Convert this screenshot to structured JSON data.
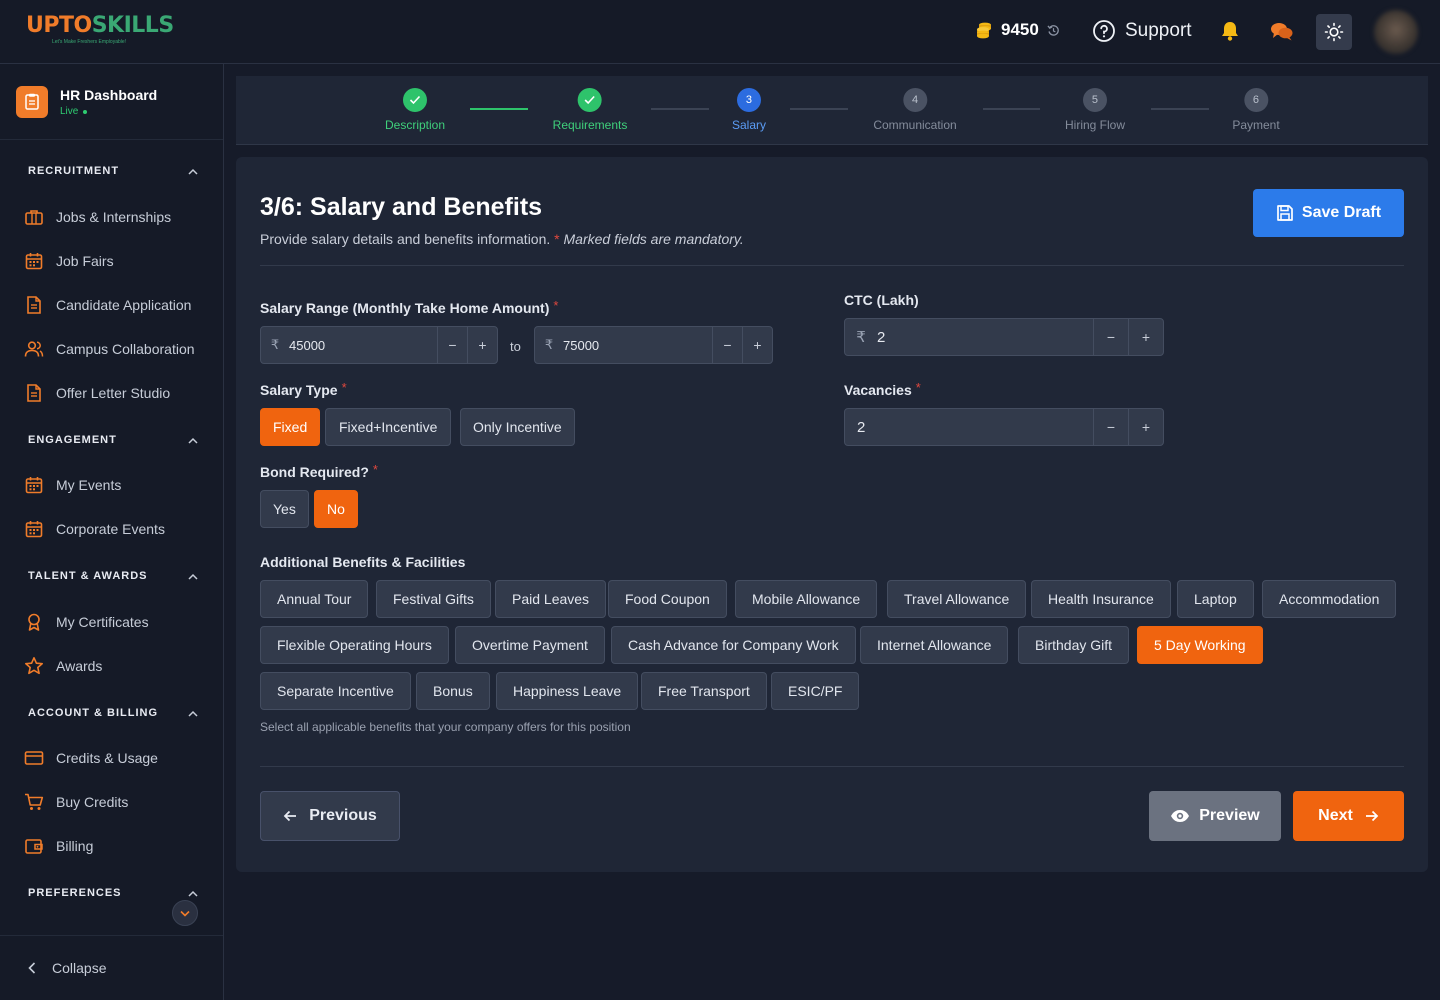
{
  "header": {
    "logo_prefix": "UPTO",
    "logo_suffix": "SKILLS",
    "logo_tagline": "Let's Make Freshers Employable!",
    "credits": "9450",
    "support_label": "Support"
  },
  "sidebar": {
    "dashboard_title": "HR Dashboard",
    "dashboard_status": "Live",
    "sections": [
      {
        "title": "RECRUITMENT",
        "items": [
          "Jobs & Internships",
          "Job Fairs",
          "Candidate Application",
          "Campus Collaboration",
          "Offer Letter Studio"
        ]
      },
      {
        "title": "ENGAGEMENT",
        "items": [
          "My Events",
          "Corporate Events"
        ]
      },
      {
        "title": "TALENT & AWARDS",
        "items": [
          "My Certificates",
          "Awards"
        ]
      },
      {
        "title": "ACCOUNT & BILLING",
        "items": [
          "Credits & Usage",
          "Buy Credits",
          "Billing"
        ]
      },
      {
        "title": "PREFERENCES",
        "items": []
      }
    ],
    "collapse_label": "Collapse"
  },
  "stepper": {
    "steps": [
      {
        "num": "1",
        "label": "Description",
        "state": "done"
      },
      {
        "num": "2",
        "label": "Requirements",
        "state": "done"
      },
      {
        "num": "3",
        "label": "Salary",
        "state": "active"
      },
      {
        "num": "4",
        "label": "Communication",
        "state": "pending"
      },
      {
        "num": "5",
        "label": "Hiring Flow",
        "state": "pending"
      },
      {
        "num": "6",
        "label": "Payment",
        "state": "pending"
      }
    ]
  },
  "form": {
    "title": "3/6: Salary and Benefits",
    "subtitle": "Provide salary details and benefits information.",
    "mandatory_note": "Marked fields are mandatory.",
    "save_draft_label": "Save Draft",
    "salary_range_label": "Salary Range (Monthly Take Home Amount)",
    "salary_min": "45000",
    "salary_max": "75000",
    "to_label": "to",
    "currency_symbol": "₹",
    "ctc_label": "CTC (Lakh)",
    "ctc_value": "2",
    "salary_type_label": "Salary Type",
    "salary_types": [
      "Fixed",
      "Fixed+Incentive",
      "Only Incentive"
    ],
    "salary_type_selected": "Fixed",
    "vacancies_label": "Vacancies",
    "vacancies_value": "2",
    "bond_label": "Bond Required?",
    "bond_options": [
      "Yes",
      "No"
    ],
    "bond_selected": "No",
    "benefits_label": "Additional Benefits & Facilities",
    "benefits": [
      "Annual Tour",
      "Festival Gifts",
      "Paid Leaves",
      "Food Coupon",
      "Mobile Allowance",
      "Travel Allowance",
      "Health Insurance",
      "Laptop",
      "Accommodation",
      "Flexible Operating Hours",
      "Overtime Payment",
      "Cash Advance for Company Work",
      "Internet Allowance",
      "Birthday Gift",
      "5 Day Working",
      "Separate Incentive",
      "Bonus",
      "Happiness Leave",
      "Free Transport",
      "ESIC/PF"
    ],
    "benefits_selected": [
      "5 Day Working"
    ],
    "benefits_hint": "Select all applicable benefits that your company offers for this position",
    "previous_label": "Previous",
    "preview_label": "Preview",
    "next_label": "Next"
  },
  "colors": {
    "accent_orange": "#f0640f",
    "primary_blue": "#2c7bea",
    "success_green": "#2ec36b",
    "background": "#161b29",
    "card": "#1f2636"
  }
}
